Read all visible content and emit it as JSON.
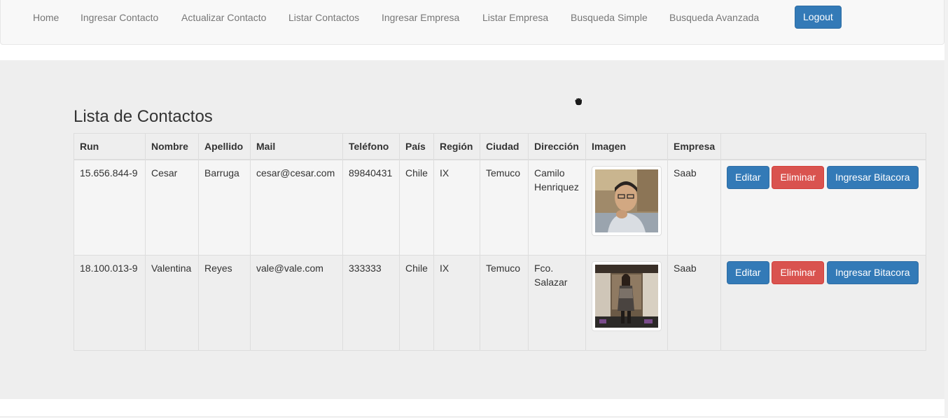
{
  "nav": {
    "home": "Home",
    "ingresar_contacto": "Ingresar Contacto",
    "actualizar_contacto": "Actualizar Contacto",
    "listar_contactos": "Listar Contactos",
    "ingresar_empresa": "Ingresar Empresa",
    "listar_empresa": "Listar Empresa",
    "busqueda_simple": "Busqueda Simple",
    "busqueda_avanzada": "Busqueda Avanzada",
    "logout": "Logout"
  },
  "page": {
    "title": "Lista de Contactos"
  },
  "table": {
    "headers": [
      "Run",
      "Nombre",
      "Apellido",
      "Mail",
      "Teléfono",
      "País",
      "Región",
      "Ciudad",
      "Dirección",
      "Imagen",
      "Empresa",
      ""
    ],
    "rows": [
      {
        "run": "15.656.844-9",
        "nombre": "Cesar",
        "apellido": "Barruga",
        "mail": "cesar@cesar.com",
        "telefono": "89840431",
        "pais": "Chile",
        "region": "IX",
        "ciudad": "Temuco",
        "direccion": "Camilo Henriquez",
        "empresa": "Saab"
      },
      {
        "run": "18.100.013-9",
        "nombre": "Valentina",
        "apellido": "Reyes",
        "mail": "vale@vale.com",
        "telefono": "333333",
        "pais": "Chile",
        "region": "IX",
        "ciudad": "Temuco",
        "direccion": "Fco. Salazar",
        "empresa": "Saab"
      }
    ],
    "actions": {
      "editar": "Editar",
      "eliminar": "Eliminar",
      "ingresar_bitacora": "Ingresar Bitacora"
    }
  },
  "icons": {
    "cursor": "hand-grab-icon"
  },
  "colors": {
    "primary": "#337ab7",
    "danger": "#d9534f",
    "jumbotron": "#eeeeee",
    "navbar": "#f8f8f8"
  }
}
